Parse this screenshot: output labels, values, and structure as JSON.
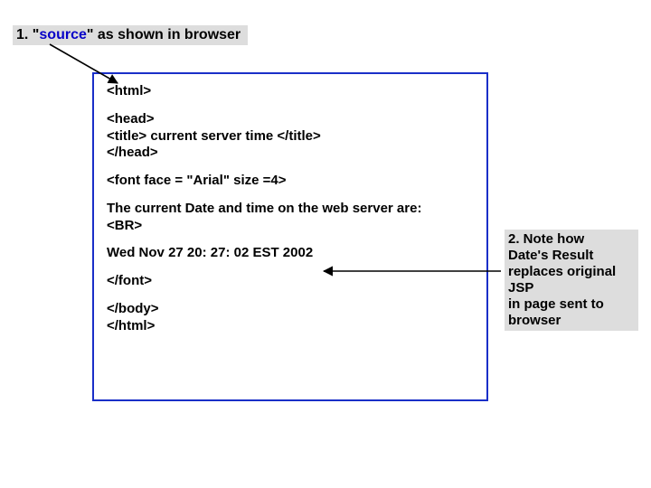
{
  "heading": {
    "num": "1.",
    "q1": "\"",
    "source": "source",
    "q2": "\"",
    "rest": "  as shown in browser"
  },
  "code": {
    "l1": "<html>",
    "l2": "<head>",
    "l3": "<title> current server time </title>",
    "l4": "</head>",
    "l5": "<font face = \"Arial\"  size =4>",
    "l6": "The current Date and time on the web server are:",
    "l7": "<BR>",
    "l8": "Wed Nov 27 20: 27: 02 EST 2002",
    "l9": "</font>",
    "l10": "</body>",
    "l11": "</html>"
  },
  "note": {
    "l1": "2. Note how",
    "l2": "Date's Result",
    "l3": "replaces original",
    "l4": "JSP",
    "l5": "in page sent to",
    "l6": "browser"
  }
}
